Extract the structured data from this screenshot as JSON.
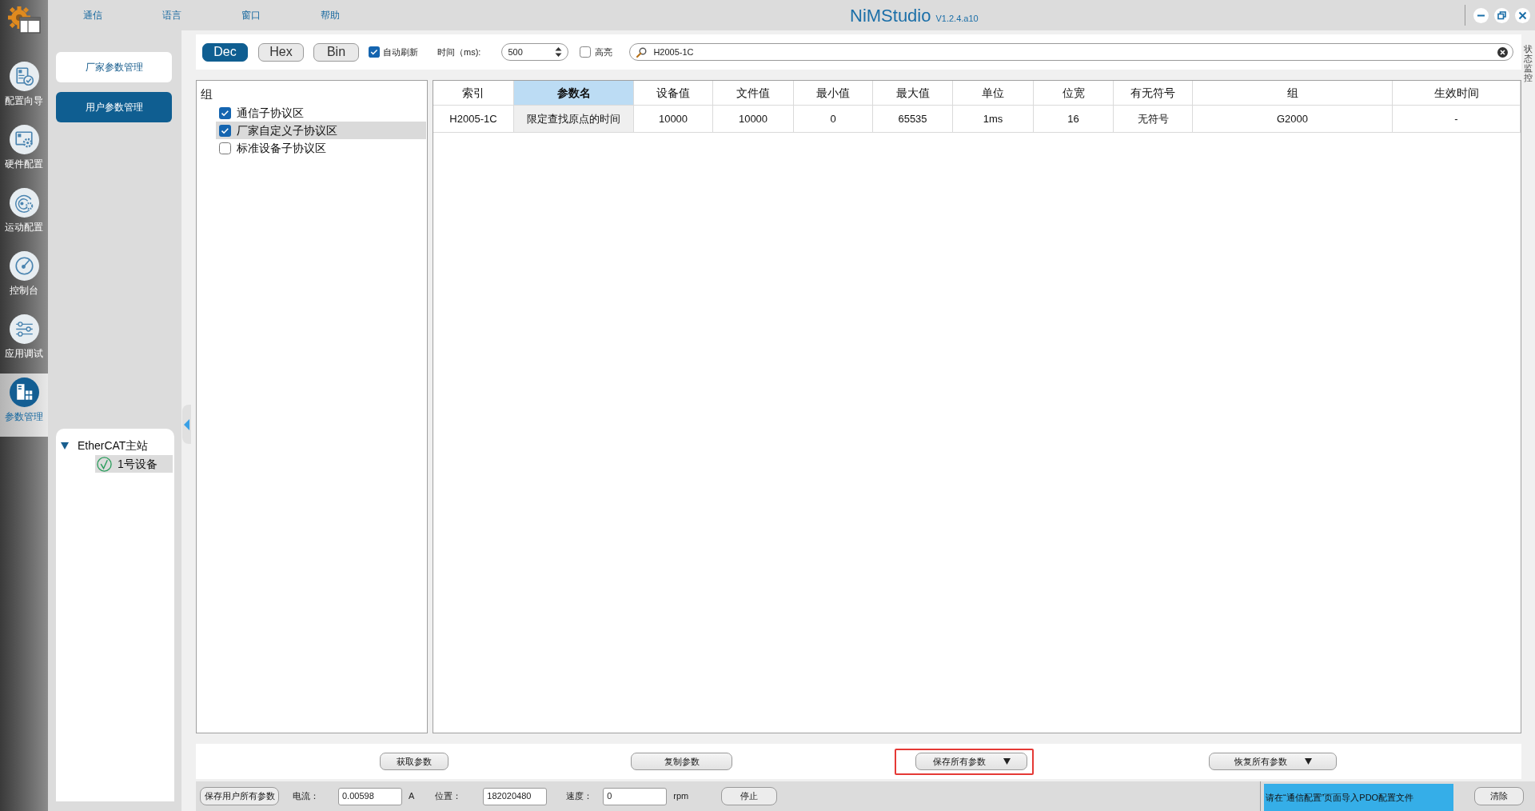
{
  "app": {
    "title": "NiMStudio",
    "version": "V1.2.4.a10"
  },
  "menu": [
    "通信",
    "语言",
    "窗口",
    "帮助"
  ],
  "nav": [
    {
      "label": "配置向导",
      "selected": false
    },
    {
      "label": "硬件配置",
      "selected": false
    },
    {
      "label": "运动配置",
      "selected": false
    },
    {
      "label": "控制台",
      "selected": false
    },
    {
      "label": "应用调试",
      "selected": false
    },
    {
      "label": "参数管理",
      "selected": true
    }
  ],
  "param_pages": [
    {
      "label": "厂家参数管理",
      "selected": false
    },
    {
      "label": "用户参数管理",
      "selected": true
    }
  ],
  "device_tree": [
    {
      "label": "EtherCAT主站",
      "expanded": true,
      "selected": false,
      "children": [
        {
          "label": "1号设备",
          "selected": true
        }
      ]
    }
  ],
  "toolbar": {
    "formats": [
      {
        "label": "Dec",
        "selected": true
      },
      {
        "label": "Hex",
        "selected": false
      },
      {
        "label": "Bin",
        "selected": false
      }
    ],
    "auto_refresh": {
      "label": "自动刷新",
      "checked": true
    },
    "interval": {
      "label": "时间（ms):",
      "value": "500"
    },
    "highlight": {
      "label": "高亮",
      "checked": false
    },
    "search": {
      "value": "H2005-1C"
    }
  },
  "groups": {
    "title": "组",
    "items": [
      {
        "label": "通信子协议区",
        "checked": true,
        "selected": false
      },
      {
        "label": "厂家自定义子协议区",
        "checked": true,
        "selected": true
      },
      {
        "label": "标准设备子协议区",
        "checked": false,
        "selected": false
      }
    ]
  },
  "table": {
    "columns": [
      {
        "label": "索引",
        "selected": false
      },
      {
        "label": "参数名",
        "selected": true
      },
      {
        "label": "设备值",
        "selected": false
      },
      {
        "label": "文件值",
        "selected": false
      },
      {
        "label": "最小值",
        "selected": false
      },
      {
        "label": "最大值",
        "selected": false
      },
      {
        "label": "单位",
        "selected": false
      },
      {
        "label": "位宽",
        "selected": false
      },
      {
        "label": "有无符号",
        "selected": false
      },
      {
        "label": "组",
        "selected": false
      },
      {
        "label": "生效时间",
        "selected": false
      }
    ],
    "rows": [
      [
        "H2005-1C",
        "限定查找原点的时间",
        "10000",
        "10000",
        "0",
        "65535",
        "1ms",
        "16",
        "无符号",
        "G2000",
        "-"
      ]
    ]
  },
  "actions": [
    {
      "label": "获取参数",
      "kind": "button",
      "highlighted": false
    },
    {
      "label": "复制参数",
      "kind": "button",
      "highlighted": false
    },
    {
      "label": "保存所有参数",
      "kind": "dropdown",
      "highlighted": true
    },
    {
      "label": "恢复所有参数",
      "kind": "dropdown",
      "highlighted": false
    }
  ],
  "status_bar": {
    "save_button": "保存用户所有参数",
    "readouts": [
      {
        "label": "电流：",
        "value": "0.00598",
        "unit": "A"
      },
      {
        "label": "位置：",
        "value": "182020480"
      },
      {
        "label": "速度：",
        "value": "0",
        "unit": "rpm"
      }
    ],
    "stop_button": "停止",
    "message": "请在“通信配置”页面导入PDO配置文件",
    "clear_button": "清除"
  },
  "side_panel": {
    "label": "状态监控"
  }
}
